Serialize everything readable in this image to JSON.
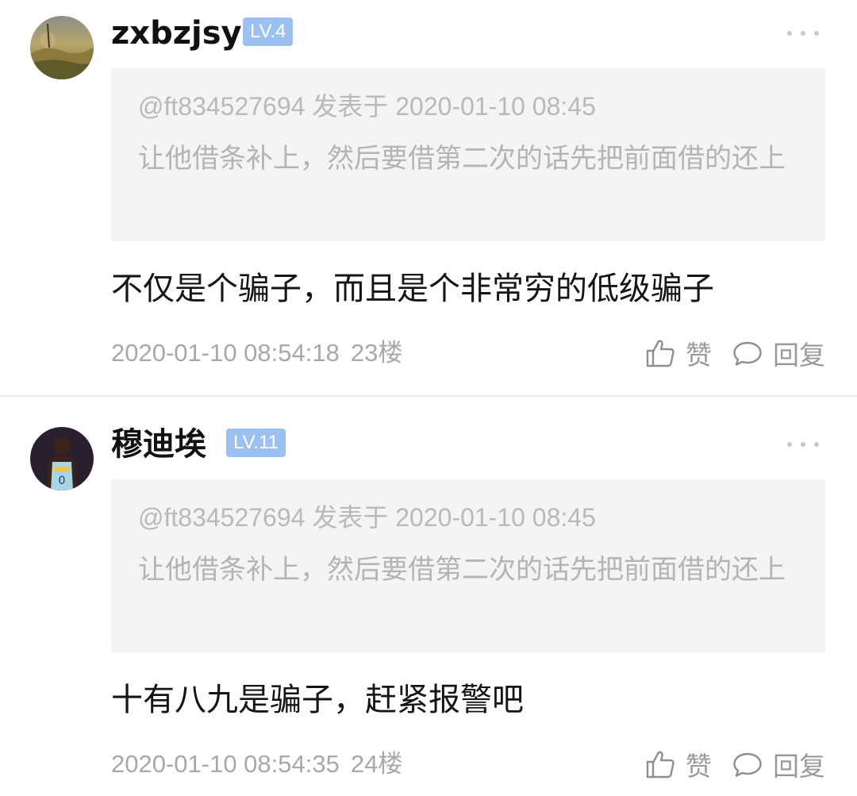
{
  "comments": [
    {
      "username": "zxbzjsy",
      "level": "LV.4",
      "quote": {
        "meta": "@ft834527694 发表于 2020-01-10 08:45",
        "text": "让他借条补上，然后要借第二次的话先把前面借的还上"
      },
      "text": "不仅是个骗子，而且是个非常穷的低级骗子",
      "timestamp": "2020-01-10 08:54:18",
      "floor": "23楼",
      "like_label": "赞",
      "reply_label": "回复",
      "avatar_icon": "landscape-avatar"
    },
    {
      "username": "穆迪埃",
      "level": "LV.11",
      "quote": {
        "meta": "@ft834527694 发表于 2020-01-10 08:45",
        "text": "让他借条补上，然后要借第二次的话先把前面借的还上"
      },
      "text": "十有八九是骗子，赶紧报警吧",
      "timestamp": "2020-01-10 08:54:35",
      "floor": "24楼",
      "like_label": "赞",
      "reply_label": "回复",
      "avatar_icon": "basketball-player-avatar"
    }
  ],
  "colors": {
    "level_badge": "#9cc1f0",
    "quote_background": "#f4f4f4",
    "meta_text": "#a8a8a8"
  },
  "icons": {
    "like": "thumbs-up-icon",
    "reply": "speech-bubble-icon",
    "more": "more-dots-icon"
  }
}
